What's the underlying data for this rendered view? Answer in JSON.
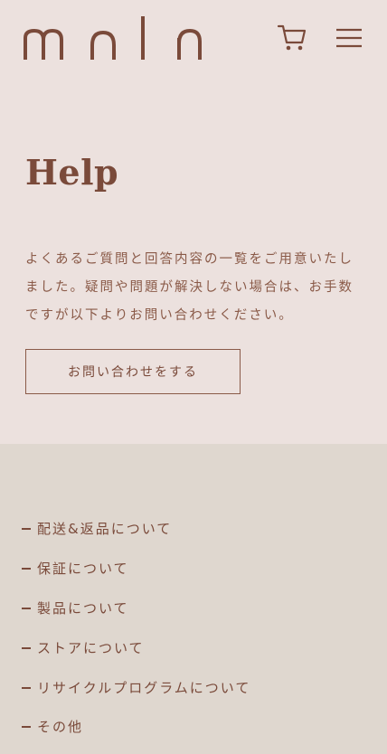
{
  "header": {
    "logo_text": "moln",
    "cart_icon": "cart-icon",
    "menu_icon": "hamburger-menu-icon"
  },
  "page": {
    "title": "Help",
    "intro_lines": [
      "よくあるご質問と回答内容の一覧をご用意いたし",
      "ました。疑問や問題が解決しない場合は、お手数",
      "ですが以下よりお問い合わせください。"
    ],
    "contact_button_label": "お問い合わせをする"
  },
  "faq": {
    "items": [
      {
        "label": "配送&返品について"
      },
      {
        "label": "保証について"
      },
      {
        "label": "製品について"
      },
      {
        "label": "ストアについて"
      },
      {
        "label": "リサイクルプログラムについて"
      },
      {
        "label": "その他"
      }
    ]
  },
  "colors": {
    "top_background": "#ece1de",
    "bottom_background": "#dfd7cf",
    "brand_brown": "#7a4a3a"
  }
}
